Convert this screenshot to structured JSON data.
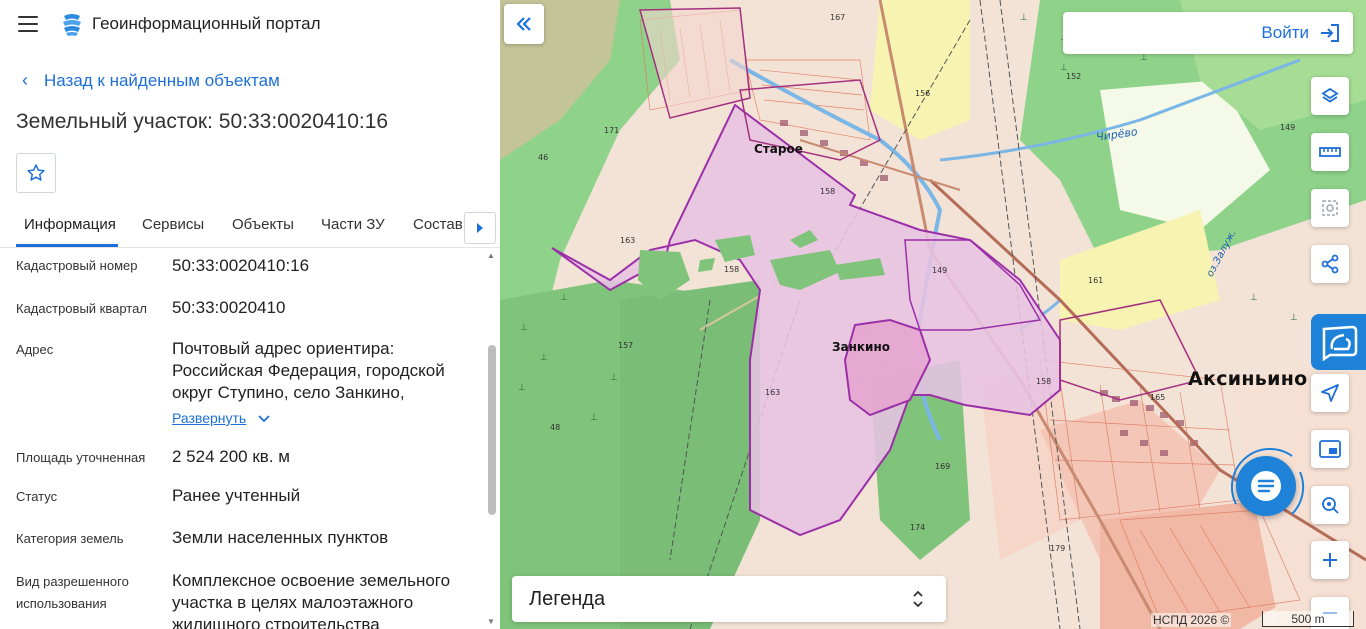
{
  "header": {
    "menu_icon": "hamburger-menu-icon",
    "logo_icon": "layers-logo-icon",
    "title": "Геоинформационный портал"
  },
  "nav": {
    "back_label": "Назад к найденным объектам"
  },
  "object": {
    "title": "Земельный участок: 50:33:0020410:16"
  },
  "tabs": [
    {
      "label": "Информация",
      "active": true
    },
    {
      "label": "Сервисы"
    },
    {
      "label": "Объекты"
    },
    {
      "label": "Части ЗУ"
    },
    {
      "label": "Состав"
    }
  ],
  "fields": [
    {
      "label": "Кадастровый номер",
      "value": "50:33:0020410:16"
    },
    {
      "label": "Кадастровый квартал",
      "value": "50:33:0020410"
    },
    {
      "label": "Адрес",
      "value_lines": [
        "Почтовый адрес ориентира:",
        "Российская Федерация, городской",
        "округ Ступино, село Занкино,"
      ],
      "expand_label": "Развернуть"
    },
    {
      "label": "Площадь уточненная",
      "value": "2 524 200 кв. м"
    },
    {
      "label": "Статус",
      "value": "Ранее учтенный"
    },
    {
      "label": "Категория земель",
      "value": "Земли населенных пунктов"
    },
    {
      "label_lines": [
        "Вид разрешенного",
        "использования"
      ],
      "value_lines": [
        "Комплексное освоение земельного",
        "участка в целях малоэтажного",
        "жилищного строительства"
      ]
    }
  ],
  "map": {
    "login_label": "Войти",
    "legend_label": "Легенда",
    "copyright": "НСПД 2026 ©",
    "scale": "500 m",
    "place_labels": {
      "aksinino": "Аксиньино",
      "zankino": "Занкино",
      "staroe": "Старое",
      "chirevo": "Чирёво",
      "zaluzhye": "оз.Залуж."
    },
    "parcel_fill": "#e7c3e3",
    "parcel_stroke": "#9b2fa8",
    "accent": "#1e6fd9"
  }
}
